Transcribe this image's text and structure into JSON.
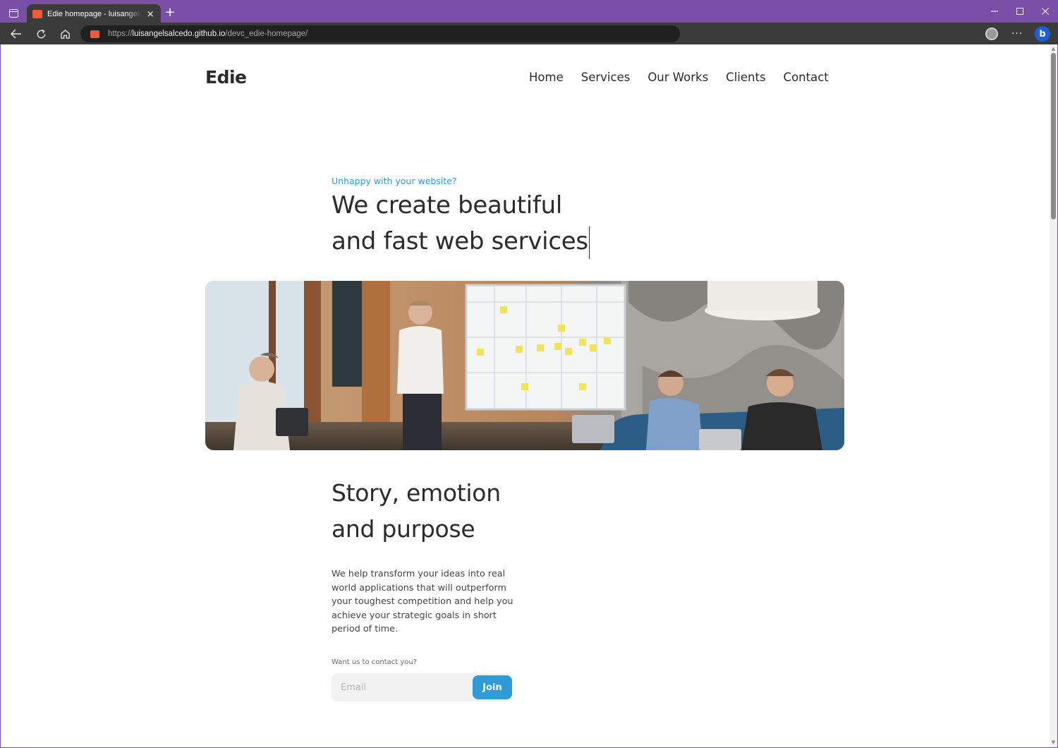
{
  "browser": {
    "tab_title": "Edie homepage - luisangelsalcedo",
    "tab_close": "×",
    "new_tab": "+",
    "url_scheme": "https://",
    "url_host": "luisangelsalcedo.github.io",
    "url_path": "/devc_edie-homepage/",
    "more_label": "···",
    "copilot_label": "b",
    "colors": {
      "frame": "#7b4fa8",
      "toolbar": "#3b3b3b",
      "urlbar": "#202020"
    }
  },
  "site": {
    "logo": "Edie",
    "nav": [
      "Home",
      "Services",
      "Our Works",
      "Clients",
      "Contact"
    ],
    "hero": {
      "eyebrow": "Unhappy with your website?",
      "title_line1": "We create beautiful",
      "title_line2": "and fast web services"
    },
    "section": {
      "title_line1": "Story, emotion",
      "title_line2": "and purpose",
      "body": "We help transform your ideas into real world applications that will outperform your toughest competition and help you achieve your strategic goals in short period of time."
    },
    "contact": {
      "label": "Want us to contact you?",
      "email_placeholder": "Email",
      "join_label": "Join"
    },
    "colors": {
      "accent": "#2f9bd8",
      "text": "#2b2b2b"
    }
  }
}
